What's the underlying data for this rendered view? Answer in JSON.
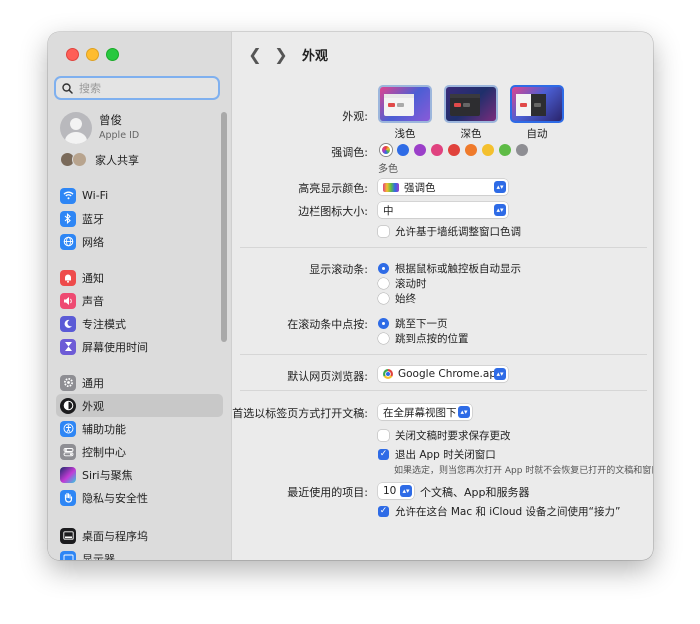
{
  "window": {
    "title": "外观"
  },
  "search": {
    "placeholder": "搜索"
  },
  "profile": {
    "name": "曾俊",
    "sub": "Apple ID"
  },
  "family": {
    "label": "家人共享"
  },
  "sidebar": {
    "group1": [
      {
        "label": "Wi-Fi",
        "icon": "wifi-icon",
        "color": "#2e86f5"
      },
      {
        "label": "蓝牙",
        "icon": "bluetooth-icon",
        "color": "#2e86f5"
      },
      {
        "label": "网络",
        "icon": "globe-icon",
        "color": "#2e86f5"
      }
    ],
    "group2": [
      {
        "label": "通知",
        "icon": "bell-icon",
        "color": "#ee4b4b"
      },
      {
        "label": "声音",
        "icon": "speaker-icon",
        "color": "#ee4b72"
      },
      {
        "label": "专注模式",
        "icon": "moon-icon",
        "color": "#5b5bd6"
      },
      {
        "label": "屏幕使用时间",
        "icon": "hourglass-icon",
        "color": "#6d5bd6"
      }
    ],
    "group3": [
      {
        "label": "通用",
        "icon": "gear-icon",
        "color": "#8e8e93"
      },
      {
        "label": "外观",
        "icon": "appearance-icon",
        "color": "#1c1c1e"
      },
      {
        "label": "辅助功能",
        "icon": "accessibility-icon",
        "color": "#2e86f5"
      },
      {
        "label": "控制中心",
        "icon": "control-center-icon",
        "color": "#8e8e93"
      },
      {
        "label": "Siri与聚焦",
        "icon": "siri-icon",
        "color": "#7a3fd1"
      },
      {
        "label": "隐私与安全性",
        "icon": "hand-icon",
        "color": "#2e86f5"
      }
    ],
    "group4": [
      {
        "label": "桌面与程序坞",
        "icon": "dock-icon",
        "color": "#1c1c1e"
      },
      {
        "label": "显示器",
        "icon": "display-icon",
        "color": "#2e86f5"
      }
    ]
  },
  "appearance": {
    "label": "外观:",
    "options": [
      {
        "label": "浅色",
        "selected": false
      },
      {
        "label": "深色",
        "selected": false
      },
      {
        "label": "自动",
        "selected": true
      }
    ]
  },
  "accent": {
    "label": "强调色:",
    "selected_name": "多色",
    "colors": [
      "multicolor",
      "#2e6be6",
      "#9b3fc9",
      "#e0427f",
      "#e0423c",
      "#ef7a2b",
      "#f4c02e",
      "#5ebb46",
      "#8e8e93"
    ]
  },
  "highlight": {
    "label": "高亮显示颜色:",
    "value": "强调色"
  },
  "sidebar_icon_size": {
    "label": "边栏图标大小:",
    "value": "中"
  },
  "wallpaper_tint": {
    "label": "允许基于墙纸调整窗口色调",
    "checked": false
  },
  "scrollbars": {
    "label": "显示滚动条:",
    "options": [
      {
        "label": "根据鼠标或触控板自动显示",
        "selected": true
      },
      {
        "label": "滚动时",
        "selected": false
      },
      {
        "label": "始终",
        "selected": false
      }
    ]
  },
  "scroll_click": {
    "label": "在滚动条中点按:",
    "options": [
      {
        "label": "跳至下一页",
        "selected": true
      },
      {
        "label": "跳到点按的位置",
        "selected": false
      }
    ]
  },
  "browser": {
    "label": "默认网页浏览器:",
    "value": "Google Chrome.app"
  },
  "tabs": {
    "label": "首选以标签页方式打开文稿:",
    "value": "在全屏幕视图下"
  },
  "ask_save": {
    "label": "关闭文稿时要求保存更改",
    "checked": false
  },
  "close_windows": {
    "label": "退出 App 时关闭窗口",
    "checked": true,
    "note": "如果选定，则当您再次打开 App 时就不会恢复已打开的文稿和窗口。"
  },
  "recent": {
    "label": "最近使用的项目:",
    "value": "10",
    "suffix": "个文稿、App和服务器"
  },
  "handoff": {
    "label": "允许在这台 Mac 和 iCloud 设备之间使用“接力”",
    "checked": true
  }
}
